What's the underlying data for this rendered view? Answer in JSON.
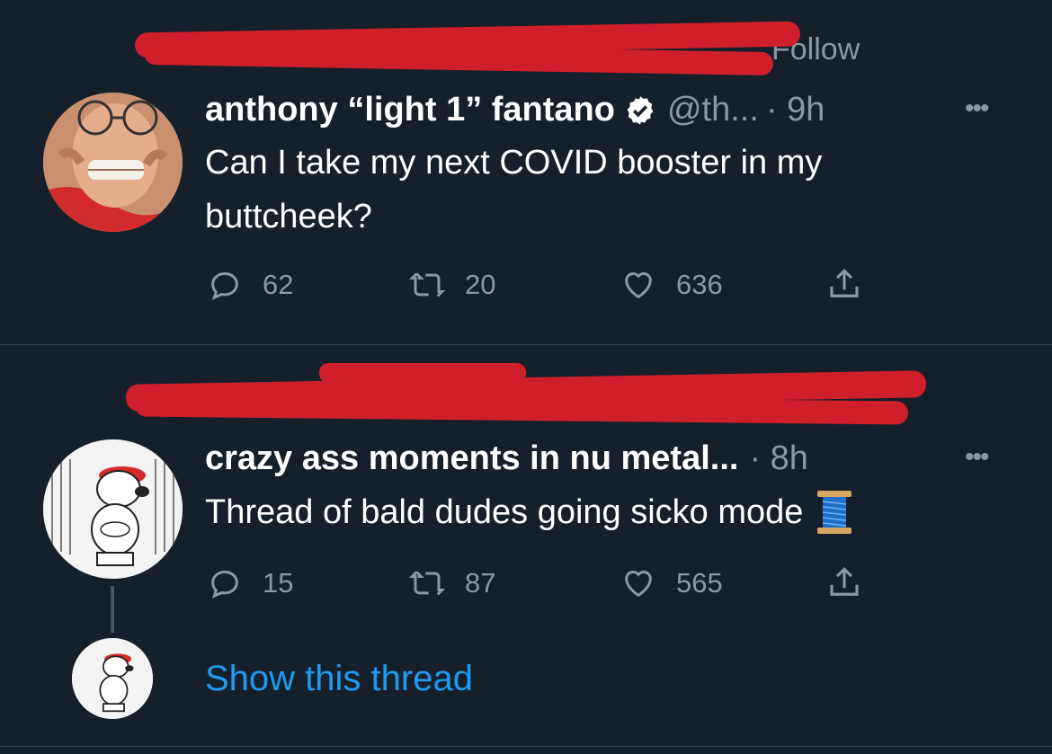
{
  "tweets": [
    {
      "context_text": "Follow",
      "display_name": "anthony “light 1” fantano",
      "handle": "@th...",
      "time": "· 9h",
      "verified": true,
      "text_line1": "Can I take my next COVID booster in my",
      "text_line2": "buttcheek?",
      "replies": "62",
      "retweets": "20",
      "likes": "636"
    },
    {
      "display_name": "crazy ass moments in nu metal...",
      "time": "· 8h",
      "text": "Thread of bald dudes going sicko mode",
      "emoji": "thread-spool",
      "replies": "15",
      "retweets": "87",
      "likes": "565"
    }
  ],
  "show_thread": "Show this thread",
  "colors": {
    "background": "#15202b",
    "secondary": "#8b98a5",
    "link": "#1d9bf0",
    "redaction": "#cf1f2b",
    "verified_badge": "#ffffff"
  }
}
